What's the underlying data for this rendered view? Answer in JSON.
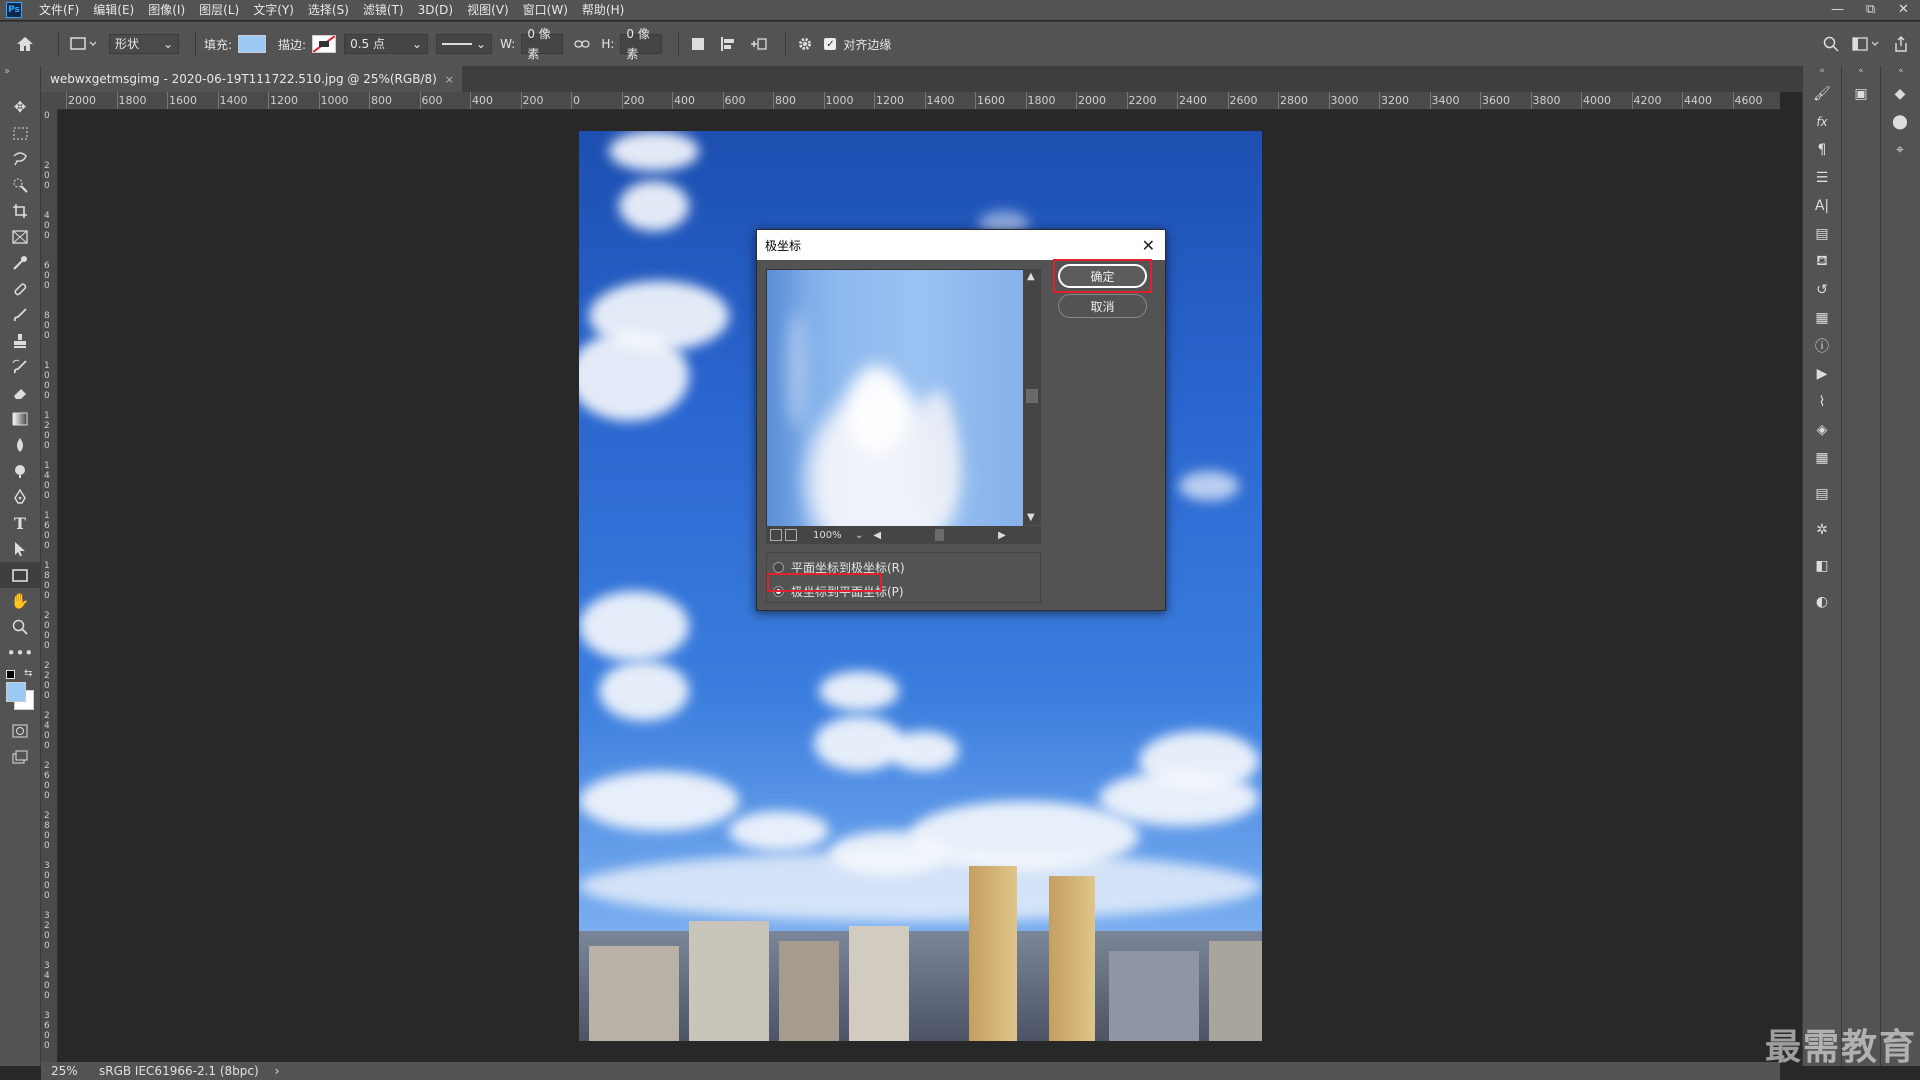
{
  "menubar": {
    "logo": "Ps",
    "items": [
      "文件(F)",
      "编辑(E)",
      "图像(I)",
      "图层(L)",
      "文字(Y)",
      "选择(S)",
      "滤镜(T)",
      "3D(D)",
      "视图(V)",
      "窗口(W)",
      "帮助(H)"
    ],
    "window_controls": [
      "—",
      "⧉",
      "✕"
    ]
  },
  "options": {
    "mode": "形状",
    "fill_label": "填充:",
    "fill_color": "#9cc8f6",
    "stroke_label": "描边:",
    "stroke_width": "0.5 点",
    "w_label": "W:",
    "w_value": "0 像素",
    "h_label": "H:",
    "h_value": "0 像素",
    "align_edges": "对齐边缘"
  },
  "document": {
    "tab_title": "webwxgetmsgimg - 2020-06-19T111722.510.jpg @ 25%(RGB/8)",
    "close": "×"
  },
  "ruler": {
    "h_labels": [
      "2000",
      "1800",
      "1600",
      "1400",
      "1200",
      "1000",
      "800",
      "600",
      "400",
      "200",
      "0",
      "200",
      "400",
      "600",
      "800",
      "1000",
      "1200",
      "1400",
      "1600",
      "1800",
      "2000",
      "2200",
      "2400",
      "2600",
      "2800",
      "3000",
      "3200",
      "3400",
      "3600",
      "3800",
      "4000",
      "4200",
      "4400",
      "4600"
    ],
    "v_labels": [
      "0",
      "2\n0\n0",
      "4\n0\n0",
      "6\n0\n0",
      "8\n0\n0",
      "1\n0\n0\n0",
      "1\n2\n0\n0",
      "1\n4\n0\n0",
      "1\n6\n0\n0",
      "1\n8\n0\n0",
      "2\n0\n0\n0",
      "2\n2\n0\n0",
      "2\n4\n0\n0",
      "2\n6\n0\n0",
      "2\n8\n0\n0",
      "3\n0\n0\n0",
      "3\n2\n0\n0",
      "3\n4\n0\n0",
      "3\n6\n0\n0"
    ]
  },
  "status": {
    "zoom": "25%",
    "profile": "sRGB IEC61966-2.1 (8bpc)",
    "arrow": "›"
  },
  "dialog": {
    "title": "极坐标",
    "close": "✕",
    "ok": "确定",
    "cancel": "取消",
    "zoom": "100%",
    "option_rect_to_polar": "平面坐标到极坐标(R)",
    "option_polar_to_rect": "极坐标到平面坐标(P)",
    "selected": "polar_to_rect"
  },
  "watermark": "最需教育"
}
